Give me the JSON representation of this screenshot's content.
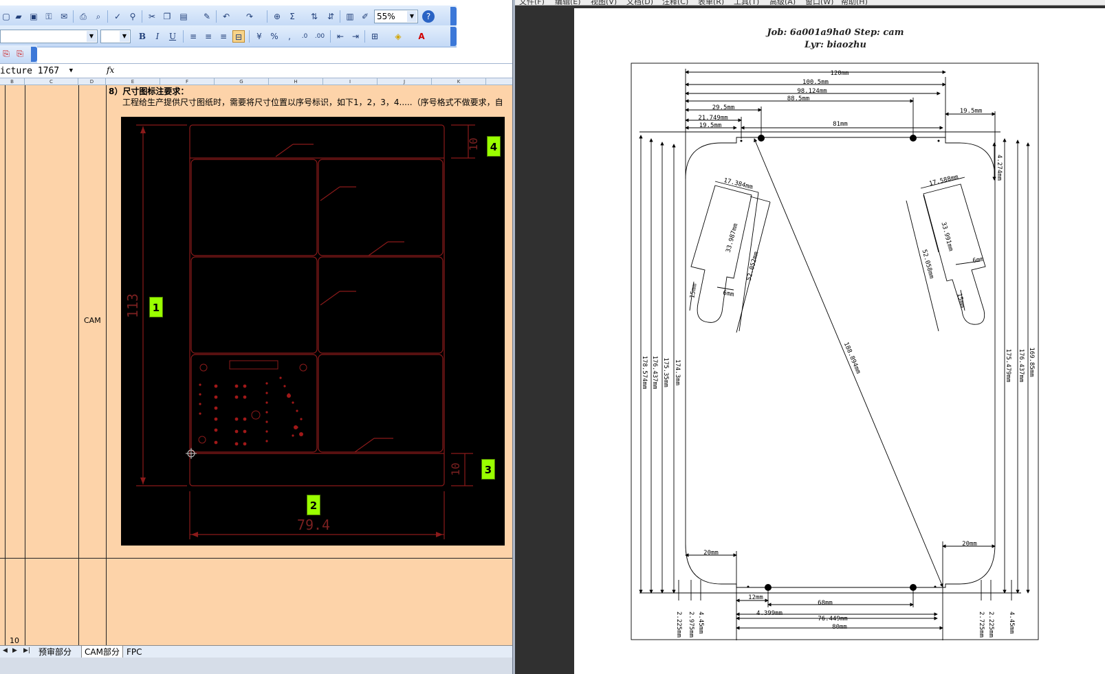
{
  "excel": {
    "zoom": "55%",
    "namebox": "icture 1767",
    "fx": "fx",
    "columns": [
      "B",
      "C",
      "D",
      "E",
      "F",
      "G",
      "H",
      "I",
      "J",
      "K"
    ],
    "cell_cam": "CAM",
    "requirement_title": "8）尺寸图标注要求：",
    "requirement_text": "工程给生产提供尺寸图纸时，需要将尺寸位置以序号标识，如下1，2，3，4.....（序号格式不做要求，自",
    "row_number": "10",
    "sheet_tabs": [
      "预审部分",
      "CAM部分",
      "FPC"
    ],
    "toolbar_icons": [
      "new-icon",
      "open-icon",
      "save-icon",
      "permission-icon",
      "print-icon",
      "print-preview-icon",
      "spelling-icon",
      "research-icon",
      "cut-icon",
      "copy-icon",
      "paste-icon",
      "format-painter-icon",
      "undo-icon",
      "redo-icon",
      "hyperlink-icon",
      "autosum-icon",
      "sort-asc-icon",
      "sort-desc-icon",
      "chart-icon",
      "drawing-icon",
      "help-icon"
    ],
    "format_buttons": [
      "B",
      "I",
      "U"
    ],
    "image": {
      "label_113": "113",
      "label_794": "79.4",
      "label_10a": "10",
      "label_10b": "10",
      "badges": [
        "1",
        "2",
        "3",
        "4"
      ]
    },
    "colors": {
      "cell_fill": "#fdd3a9",
      "badge": "#9aff00",
      "cad_line": "#8b1a1a"
    }
  },
  "viewer": {
    "menu": [
      "文件(F)",
      "编辑(E)",
      "视图(V)",
      "文档(D)",
      "注释(C)",
      "表单(R)",
      "工具(T)",
      "高级(A)",
      "窗口(W)",
      "帮助(H)"
    ],
    "job_line": "Job: 6a001a9ha0  Step: cam",
    "lyr_line": "Lyr: biaozhu",
    "dims": {
      "d120": "120mm",
      "d100": "100.5mm",
      "d98": "98.124mm",
      "d88": "88.5mm",
      "d29": "29.5mm",
      "d21": "21.749mm",
      "d19a": "19.5mm",
      "d81": "81mm",
      "d19b": "19.5mm",
      "d4274": "4.274mm",
      "d17a": "17.384mm",
      "d17b": "17.588mm",
      "d33a": "33.987mm",
      "d52a": "52.052mm",
      "d33b": "33.991mm",
      "d52b": "52.058mm",
      "d15a": "15mm",
      "d6a": "6mm",
      "d15b": "15mm",
      "d6b": "6mm",
      "d188": "188.894mm",
      "d178": "178.574mm",
      "d176a": "176.437mm",
      "d175a": "175.35mm",
      "d174": "174.3mm",
      "d175b": "175.479mm",
      "d176b": "176.437mm",
      "d169": "169.85mm",
      "d20a": "20mm",
      "d20b": "20mm",
      "d12": "12mm",
      "d68": "68mm",
      "d4399": "4.399mm",
      "d76": "76.449mm",
      "d80": "80mm",
      "d2225a": "2.225mm",
      "d2975": "2.975mm",
      "d445a": "4.45mm",
      "d2725": "2.725mm",
      "d2225b": "2.225mm",
      "d445b": "4.45mm"
    }
  }
}
